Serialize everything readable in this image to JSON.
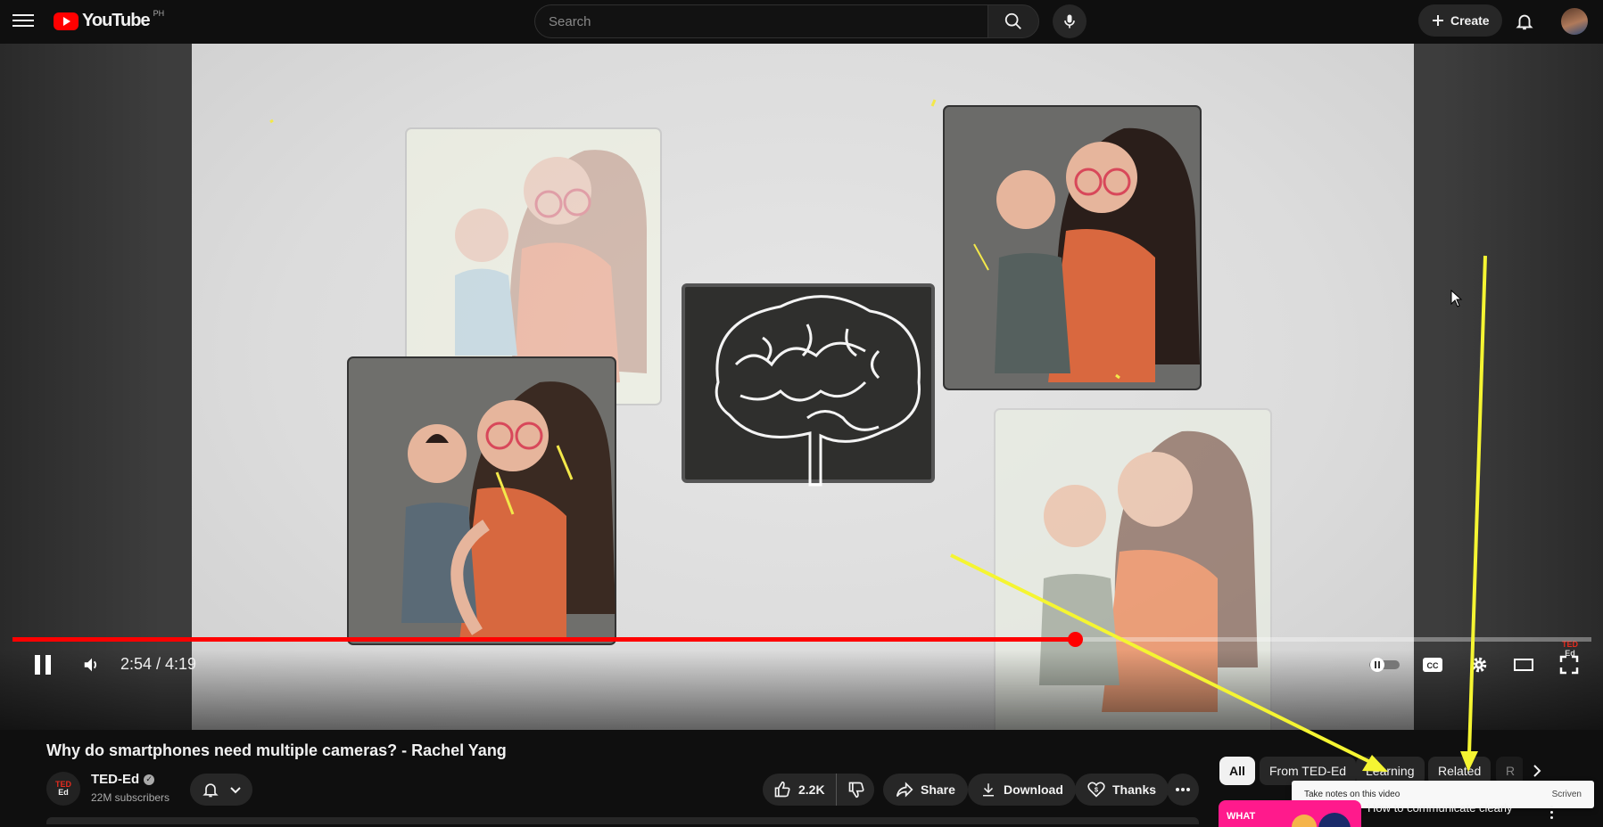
{
  "header": {
    "logo_text": "YouTube",
    "country_code": "PH",
    "search_placeholder": "Search",
    "create_label": "Create"
  },
  "player": {
    "current_time": "2:54",
    "duration": "4:19",
    "time_display": "2:54 / 4:19",
    "progress_fraction": 0.673,
    "watermark_top": "TED",
    "watermark_bottom": "Ed"
  },
  "video": {
    "title": "Why do smartphones need multiple cameras? - Rachel Yang",
    "channel": {
      "avatar_top": "TED",
      "avatar_bottom": "Ed",
      "name": "TED-Ed",
      "subscribers": "22M subscribers"
    },
    "actions": {
      "like_count": "2.2K",
      "share_label": "Share",
      "download_label": "Download",
      "thanks_label": "Thanks"
    }
  },
  "sidebar": {
    "chips": [
      "All",
      "From TED-Ed",
      "Learning",
      "Related",
      "R"
    ],
    "notes_toast": {
      "text": "Take notes on this video",
      "brand": "Scriven"
    },
    "recommendation": {
      "thumb_text": "WHAT",
      "title": "How to communicate clearly"
    }
  },
  "colors": {
    "accent": "#ff0000",
    "annotation_arrow": "#f5f532",
    "background": "#0f0f0f"
  }
}
